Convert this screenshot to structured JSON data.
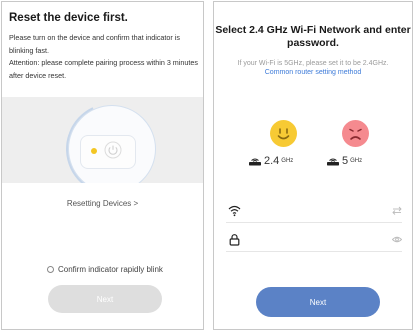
{
  "left_screen": {
    "title": "Reset the device first.",
    "desc_line1": "Please turn on the device and confirm that indicator is blinking fast.",
    "desc_line2": "Attention: please complete pairing process within 3 minutes after device reset.",
    "reset_link": "Resetting Devices >",
    "confirm_label": "Confirm indicator rapidly blink",
    "next_label": "Next",
    "indicator_color": "#f3c623"
  },
  "right_screen": {
    "title": "Select 2.4 GHz Wi-Fi Network and enter password.",
    "subtitle": "If your Wi-Fi is 5GHz, please set it to be 2.4GHz.",
    "router_link": "Common router setting method",
    "band_24_main": "2.4",
    "band_24_unit": "GHz",
    "band_5_main": "5",
    "band_5_unit": "GHz",
    "wifi_value": "",
    "password_value": "",
    "next_label": "Next",
    "accent_color": "#5b82c6",
    "link_color": "#3d7bd9"
  }
}
